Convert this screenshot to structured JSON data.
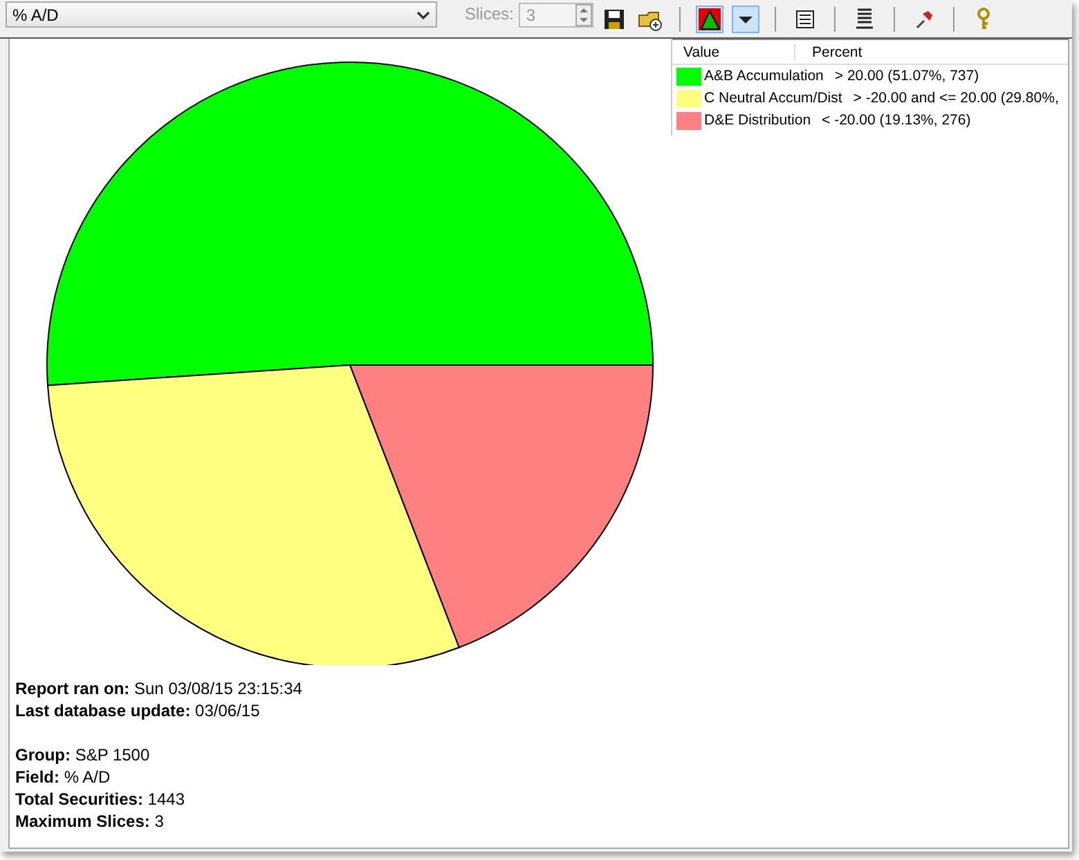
{
  "toolbar": {
    "field_select": "% A/D",
    "slices_label": "Slices:",
    "slices_value": "3",
    "slices_disabled": true
  },
  "legend": {
    "columns": [
      "Value",
      "Percent"
    ],
    "rows": [
      {
        "range": "> 20.00 (51.07%, 737)",
        "color": "#00ff00"
      },
      {
        "range": "> -20.00 and <= 20.00 (29.80%,",
        "color": "#ffff80"
      },
      {
        "range": "< -20.00 (19.13%, 276)",
        "color": "#ff8080"
      }
    ]
  },
  "chart_data": {
    "type": "pie",
    "categories": [
      "A&B Accumulation",
      "C Neutral Accum/Dist",
      "D&E Distribution"
    ],
    "values": [
      51.07,
      29.8,
      19.13
    ]
  },
  "report": [
    {
      "label": "Report ran on:",
      "value": "Sun 03/08/15 23:15:34"
    },
    {
      "label": "Last database update:",
      "value": "03/06/15",
      "gap_after": true
    },
    {
      "label": "Group:",
      "value": "S&P 1500"
    },
    {
      "label": "Field:",
      "value": "% A/D"
    },
    {
      "label": "Total Securities:",
      "value": "1443"
    },
    {
      "label": "Maximum Slices:",
      "value": "3"
    }
  ]
}
